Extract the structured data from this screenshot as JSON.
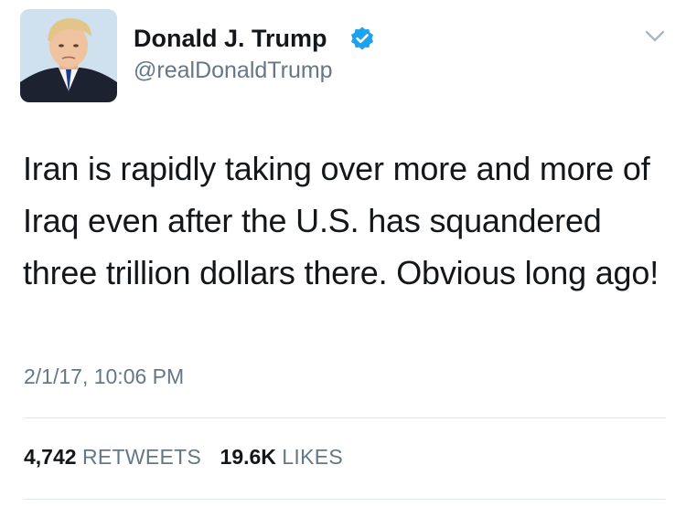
{
  "user": {
    "display_name": "Donald J. Trump",
    "handle": "@realDonaldTrump",
    "verified": true,
    "avatar_icon": "profile-photo"
  },
  "tweet": {
    "text": "Iran is rapidly taking over more and more of Iraq even after the U.S. has squandered three trillion dollars there. Obvious long ago!",
    "timestamp": "2/1/17, 10:06 PM"
  },
  "stats": {
    "retweets_count": "4,742",
    "retweets_label": "RETWEETS",
    "likes_count": "19.6K",
    "likes_label": "LIKES"
  },
  "colors": {
    "text": "#14171a",
    "secondary": "#657786",
    "verified": "#1da1f2",
    "divider": "#e1e8ed"
  },
  "icons": {
    "verified": "verified-badge-icon",
    "menu": "chevron-down-icon"
  }
}
